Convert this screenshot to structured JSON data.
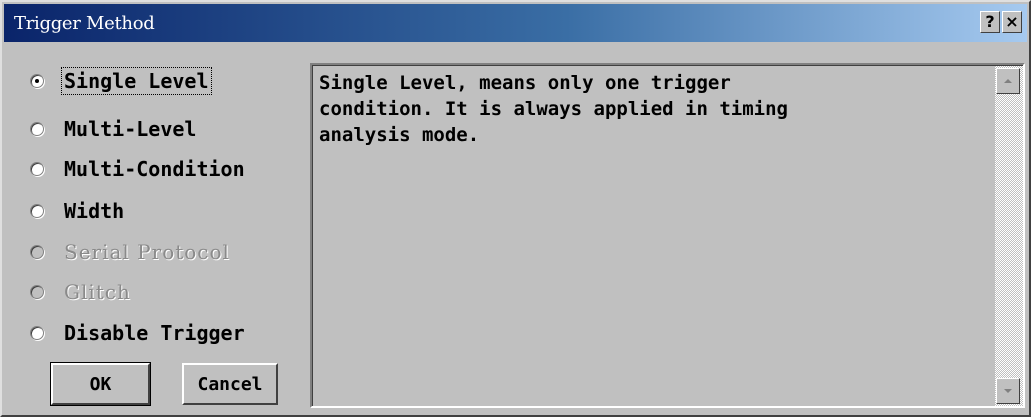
{
  "window": {
    "title": "Trigger Method",
    "help_label": "?",
    "close_label": "×"
  },
  "options": [
    {
      "label": "Single Level",
      "checked": true,
      "enabled": true
    },
    {
      "label": "Multi-Level",
      "checked": false,
      "enabled": true
    },
    {
      "label": "Multi-Condition",
      "checked": false,
      "enabled": true
    },
    {
      "label": "Width",
      "checked": false,
      "enabled": true
    },
    {
      "label": "Serial Protocol",
      "checked": false,
      "enabled": false
    },
    {
      "label": "Glitch",
      "checked": false,
      "enabled": false
    },
    {
      "label": "Disable Trigger",
      "checked": false,
      "enabled": true
    }
  ],
  "buttons": {
    "ok_label": "OK",
    "cancel_label": "Cancel"
  },
  "description": {
    "text": "Single Level, means only one trigger\ncondition. It is always applied in timing\nanalysis mode."
  }
}
